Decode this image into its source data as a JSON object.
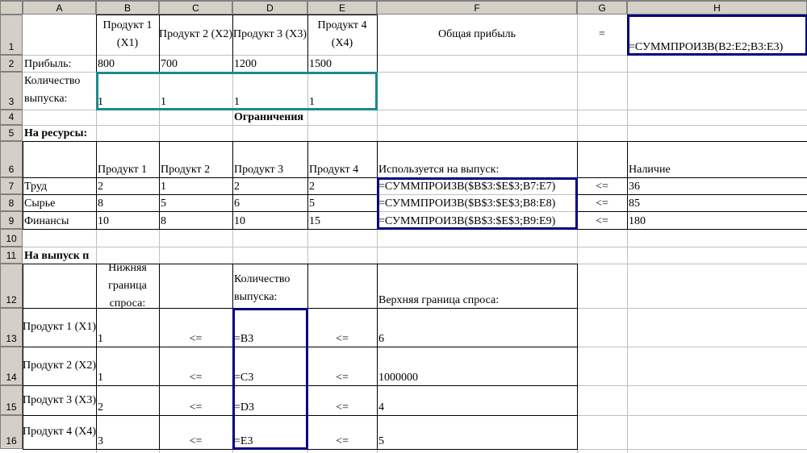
{
  "columns": [
    "A",
    "B",
    "C",
    "D",
    "E",
    "F",
    "G",
    "H"
  ],
  "rows": [
    "1",
    "2",
    "3",
    "4",
    "5",
    "6",
    "7",
    "8",
    "9",
    "10",
    "11",
    "12",
    "13",
    "14",
    "15",
    "16"
  ],
  "cells": {
    "B1": "Продукт 1 (X1)",
    "C1": "Продукт 2 (X2)",
    "D1": "Продукт 3 (X3)",
    "E1": "Продукт 4 (X4)",
    "F1": "Общая прибыль",
    "G1": "=",
    "H1": "=СУММПРОИЗВ(B2:E2;B3:E3)",
    "A2": "Прибыль:",
    "B2": "800",
    "C2": "700",
    "D2": "1200",
    "E2": "1500",
    "A3": "Количество выпуска:",
    "B3": "1",
    "C3": "1",
    "D3": "1",
    "E3": "1",
    "D4": "Ограничения",
    "A5": "На ресурсы:",
    "B6": "Продукт 1",
    "C6": "Продукт 2",
    "D6": "Продукт 3",
    "E6": "Продукт 4",
    "F6": "Используется на выпуск:",
    "H6": "Наличие",
    "A7": "Труд",
    "B7": "2",
    "C7": "1",
    "D7": "2",
    "E7": "2",
    "F7": "=СУММПРОИЗВ($B$3:$E$3;B7:E7)",
    "G7": "<=",
    "H7": "36",
    "A8": "Сырье",
    "B8": "8",
    "C8": "5",
    "D8": "6",
    "E8": "5",
    "F8": "=СУММПРОИЗВ($B$3:$E$3;B8:E8)",
    "G8": "<=",
    "H8": "85",
    "A9": "Финансы",
    "B9": "10",
    "C9": "8",
    "D9": "10",
    "E9": "15",
    "F9": "=СУММПРОИЗВ($B$3:$E$3;B9:E9)",
    "G9": "<=",
    "H9": "180",
    "A11": "На выпуск п",
    "B12": "Нижняя граница спроса:",
    "D12": "Количество выпуска:",
    "F12": "Верхняя граница спроса:",
    "A13": "Продукт 1 (X1)",
    "B13": "1",
    "C13": "<=",
    "D13": "=B3",
    "E13": "<=",
    "F13": "6",
    "A14": "Продукт 2 (X2)",
    "B14": "1",
    "C14": "<=",
    "D14": "=C3",
    "E14": "<=",
    "F14": "1000000",
    "A15": "Продукт 3 (X3)",
    "B15": "2",
    "C15": "<=",
    "D15": "=D3",
    "E15": "<=",
    "F15": "4",
    "A16": "Продукт 4 (X4)",
    "B16": "3",
    "C16": "<=",
    "D16": "=E3",
    "E16": "<=",
    "F16": "5"
  }
}
